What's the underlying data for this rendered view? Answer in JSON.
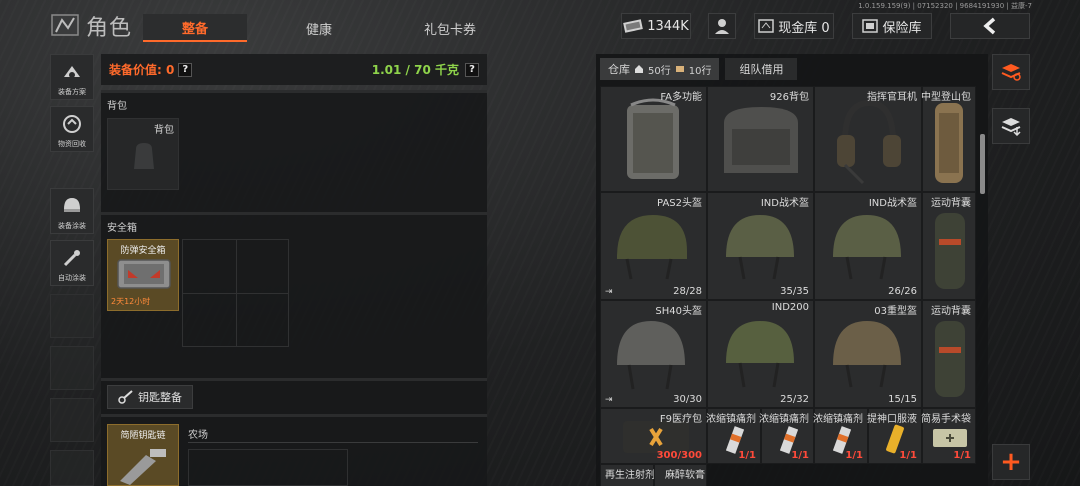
{
  "header": {
    "title": "角色",
    "tabs": [
      {
        "label": "整备",
        "active": true
      },
      {
        "label": "健康"
      },
      {
        "label": "礼包卡券"
      }
    ],
    "version": "1.0.159.159(9) | 07152320 | 9684191930 | 益康-7",
    "coins": "1344K",
    "cash_vault_label": "现金库 0",
    "vault_label": "保险库",
    "back_icon": "chevron-left-icon"
  },
  "sidebar": {
    "buttons": [
      {
        "label": "装备方案",
        "icon": "loadout-icon"
      },
      {
        "label": "物资回收",
        "icon": "recycle-icon"
      },
      {
        "label": "装备涂装",
        "icon": "paint-helmet-icon"
      },
      {
        "label": "自动涂装",
        "icon": "auto-paint-icon"
      }
    ]
  },
  "equipment": {
    "value_label": "装备价值: 0",
    "weight_label": "1.01 / 70 千克",
    "help": "?",
    "backpack_section": "背包",
    "backpack_slot": "背包",
    "safebox_section": "安全箱",
    "safebox_item": "防弹安全箱",
    "safebox_time": "2天12小时",
    "key_button": "钥匙整备",
    "keychain_item": "简陋钥匙链",
    "farm_label": "农场"
  },
  "warehouse": {
    "tab_warehouse": "仓库",
    "rows_label": "50行",
    "extra_rows_label": "10行",
    "tab_team": "组队借用",
    "items": [
      {
        "name": "FA多功能",
        "count": ""
      },
      {
        "name": "926背包",
        "count": ""
      },
      {
        "name": "指挥官耳机",
        "count": ""
      },
      {
        "name": "中型登山包",
        "count": ""
      },
      {
        "name": "PAS2头盔",
        "count": "28/28"
      },
      {
        "name": "IND战术盔",
        "count": "35/35"
      },
      {
        "name": "IND战术盔",
        "count": "26/26"
      },
      {
        "name": "运动背囊",
        "count": ""
      },
      {
        "name": "SH40头盔",
        "count": "30/30"
      },
      {
        "name": "IND200",
        "count": "25/32"
      },
      {
        "name": "03重型盔",
        "count": "15/15"
      },
      {
        "name": "运动背囊",
        "count": ""
      },
      {
        "name": "F9医疗包",
        "count": "300/300"
      },
      {
        "name": "浓缩镇痛剂",
        "count": "1/1"
      },
      {
        "name": "浓缩镇痛剂",
        "count": "1/1"
      },
      {
        "name": "浓缩镇痛剂",
        "count": "1/1"
      },
      {
        "name": "提神口服液",
        "count": "1/1"
      },
      {
        "name": "简易手术袋",
        "count": "1/1"
      },
      {
        "name": "再生注射剂",
        "count": ""
      },
      {
        "name": "麻醉软膏",
        "count": ""
      }
    ],
    "add_label": "+"
  },
  "colors": {
    "accent": "#ff6a2b",
    "weight": "#8fd44b",
    "red_count": "#ff4a3a"
  }
}
